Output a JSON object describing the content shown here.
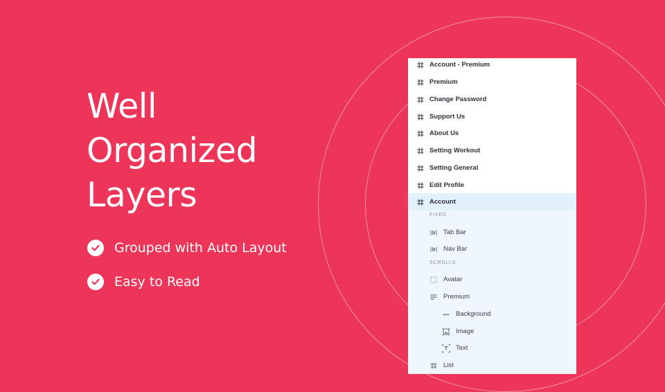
{
  "hero": {
    "headline": [
      "Well",
      "Organized",
      "Layers"
    ],
    "features": [
      "Grouped with Auto Layout",
      "Easy to Read"
    ]
  },
  "layers": {
    "frames": [
      "Account - Premium",
      "Premium",
      "Change Password",
      "Support Us",
      "About Us",
      "Setting Workout",
      "Setting General",
      "Edit Profile",
      "Account"
    ],
    "selected": "Account",
    "sections": {
      "fixed": "FIXED",
      "scrolls": "SCROLLS"
    },
    "fixed_items": [
      {
        "label": "Tab Bar",
        "icon": "horizontal-auto-layout-icon"
      },
      {
        "label": "Nav Bar",
        "icon": "horizontal-auto-layout-icon"
      }
    ],
    "scroll_items": [
      {
        "label": "Avatar",
        "icon": "dashed-frame-icon"
      },
      {
        "label": "Premium",
        "icon": "vertical-auto-layout-icon"
      }
    ],
    "premium_children": [
      {
        "label": "Background",
        "icon": "rectangle-icon"
      },
      {
        "label": "Image",
        "icon": "image-frame-icon"
      },
      {
        "label": "Text",
        "icon": "text-icon"
      }
    ],
    "last_item": {
      "label": "List",
      "icon": "frame-hash-icon"
    }
  },
  "colors": {
    "background": "#EC3558",
    "panel": "#FFFFFF",
    "selection": "#E3F1FC",
    "children_bg": "#EFF6FC"
  }
}
